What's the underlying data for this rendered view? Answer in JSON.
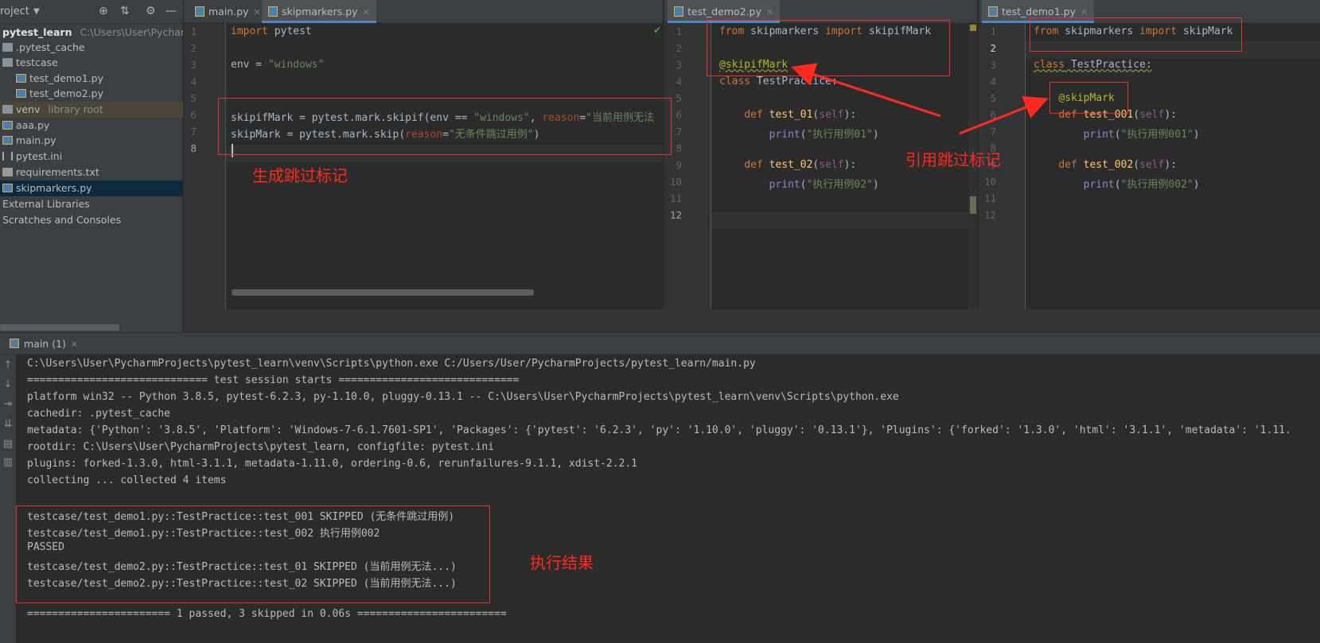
{
  "project": {
    "title": "roject",
    "tree": [
      {
        "name": "pytest_learn",
        "extra": "C:\\Users\\User\\PycharmPr",
        "type": "root"
      },
      {
        "name": ".pytest_cache",
        "type": "folder"
      },
      {
        "name": "testcase",
        "type": "folder"
      },
      {
        "name": "test_demo1.py",
        "type": "py"
      },
      {
        "name": "test_demo2.py",
        "type": "py"
      },
      {
        "name": "venv",
        "extra": "library root",
        "type": "folder"
      },
      {
        "name": "aaa.py",
        "type": "py"
      },
      {
        "name": "main.py",
        "type": "py"
      },
      {
        "name": "pytest.ini",
        "type": "ini"
      },
      {
        "name": "requirements.txt",
        "type": "txt"
      },
      {
        "name": "skipmarkers.py",
        "type": "py"
      },
      {
        "name": "External Libraries",
        "type": "plain"
      },
      {
        "name": "Scratches and Consoles",
        "type": "plain"
      }
    ]
  },
  "tabs": {
    "left": [
      {
        "label": "main.py"
      },
      {
        "label": "skipmarkers.py"
      }
    ],
    "middle": [
      {
        "label": "test_demo2.py"
      }
    ],
    "right": [
      {
        "label": "test_demo1.py"
      }
    ]
  },
  "editor_left": {
    "lines": [
      "1",
      "2",
      "3",
      "4",
      "5",
      "6",
      "7",
      "8"
    ],
    "code": {
      "l1_kw": "import",
      "l1_rest": " pytest",
      "l3_a": "env = ",
      "l3_str": "\"windows\"",
      "l6_a": "skipifMark = pytest.mark.skipif(env == ",
      "l6_str": "\"windows\"",
      "l6_b": ", ",
      "l6_param": "reason",
      "l6_c": "=",
      "l6_str2": "\"当前用例无法",
      "l7_a": "skipMark = pytest.mark.skip(",
      "l7_param": "reason",
      "l7_b": "=",
      "l7_str": "\"无条件跳过用例\"",
      "l7_c": ")"
    }
  },
  "editor_middle": {
    "lines": [
      "1",
      "2",
      "3",
      "4",
      "5",
      "6",
      "7",
      "8",
      "9",
      "10",
      "11",
      "12"
    ],
    "code": {
      "l1_kw": "from",
      "l1_mid": " skipmarkers ",
      "l1_kw2": "import",
      "l1_rest": " skipifMark",
      "l3_deco": "@skipifMark",
      "l4_kw": "class",
      "l4_rest": " TestPractice:",
      "l6_kw": "def",
      "l6_fn": " test_01",
      "l6_a": "(",
      "l6_self": "self",
      "l6_b": "):",
      "l7_builtin": "print",
      "l7_a": "(",
      "l7_str": "\"执行用例01\"",
      "l7_b": ")",
      "l9_kw": "def",
      "l9_fn": " test_02",
      "l9_a": "(",
      "l9_self": "self",
      "l9_b": "):",
      "l10_builtin": "print",
      "l10_a": "(",
      "l10_str": "\"执行用例02\"",
      "l10_b": ")"
    }
  },
  "editor_right": {
    "lines": [
      "1",
      "2",
      "3",
      "4",
      "5",
      "6",
      "7",
      "8",
      "9",
      "10",
      "11",
      "12"
    ],
    "code": {
      "l1_kw": "from",
      "l1_mid": " skipmarkers ",
      "l1_kw2": "import",
      "l1_rest": " skipMark",
      "l3_kw": "class",
      "l3_rest": " TestPractice:",
      "l5_deco": "@skipMark",
      "l6_kw": "def",
      "l6_fn": " test_001",
      "l6_a": "(",
      "l6_self": "self",
      "l6_b": "):",
      "l7_builtin": "print",
      "l7_a": "(",
      "l7_str": "\"执行用例001\"",
      "l7_b": ")",
      "l9_kw": "def",
      "l9_fn": " test_002",
      "l9_a": "(",
      "l9_self": "self",
      "l9_b": "):",
      "l10_builtin": "print",
      "l10_a": "(",
      "l10_str": "\"执行用例002\"",
      "l10_b": ")"
    }
  },
  "annotations": {
    "generate": "生成跳过标记",
    "reference": "引用跳过标记",
    "result": "执行结果"
  },
  "run": {
    "tab_label": "main (1)",
    "lines": [
      "C:\\Users\\User\\PycharmProjects\\pytest_learn\\venv\\Scripts\\python.exe C:/Users/User/PycharmProjects/pytest_learn/main.py",
      "============================= test session starts =============================",
      "platform win32 -- Python 3.8.5, pytest-6.2.3, py-1.10.0, pluggy-0.13.1 -- C:\\Users\\User\\PycharmProjects\\pytest_learn\\venv\\Scripts\\python.exe",
      "cachedir: .pytest_cache",
      "metadata: {'Python': '3.8.5', 'Platform': 'Windows-7-6.1.7601-SP1', 'Packages': {'pytest': '6.2.3', 'py': '1.10.0', 'pluggy': '0.13.1'}, 'Plugins': {'forked': '1.3.0', 'html': '3.1.1', 'metadata': '1.11.",
      "rootdir: C:\\Users\\User\\PycharmProjects\\pytest_learn, configfile: pytest.ini",
      "plugins: forked-1.3.0, html-3.1.1, metadata-1.11.0, ordering-0.6, rerunfailures-9.1.1, xdist-2.2.1",
      "collecting ... collected 4 items",
      "",
      "testcase/test_demo1.py::TestPractice::test_001 SKIPPED (无条件跳过用例)",
      "testcase/test_demo1.py::TestPractice::test_002 执行用例002",
      "PASSED",
      "testcase/test_demo2.py::TestPractice::test_01 SKIPPED (当前用例无法...)",
      "testcase/test_demo2.py::TestPractice::test_02 SKIPPED (当前用例无法...)",
      "",
      "======================= 1 passed, 3 skipped in 0.06s ========================"
    ]
  }
}
